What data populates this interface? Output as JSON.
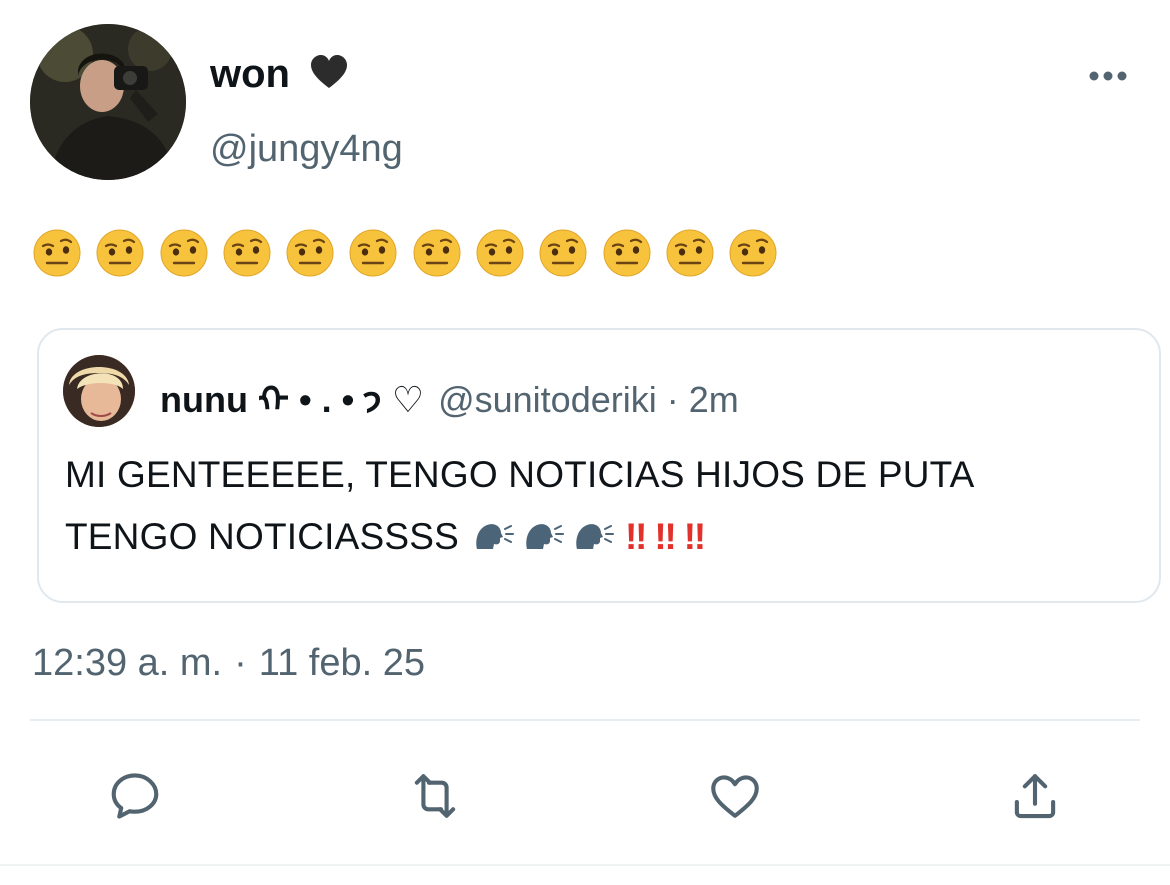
{
  "tweet": {
    "author": {
      "display_name": "won",
      "name_emoji": "black-heart",
      "handle": "@jungy4ng"
    },
    "body_emoji": "face-with-raised-eyebrow",
    "body_emoji_count": 12,
    "quoted": {
      "display_name": "nunu",
      "name_decoration": "ᡣ • . • 𐭩 ♡",
      "handle": "@sunitoderiki",
      "separator": "·",
      "time": "2m",
      "text_line1": "MI GENTEEEEE, TENGO NOTICIAS HIJOS DE PUTA",
      "text_line2": "TENGO NOTICIASSSS",
      "emoji_icons": [
        "speaking-head",
        "speaking-head",
        "speaking-head"
      ],
      "exclamations": [
        "‼",
        "‼",
        "‼"
      ]
    },
    "timestamp": {
      "time": "12:39 a. m.",
      "separator": "·",
      "date": "11 feb. 25"
    }
  },
  "actions": [
    {
      "name": "reply",
      "icon": "reply-icon"
    },
    {
      "name": "retweet",
      "icon": "retweet-icon"
    },
    {
      "name": "like",
      "icon": "heart-icon"
    },
    {
      "name": "share",
      "icon": "share-icon"
    }
  ],
  "colors": {
    "text": "#0f1419",
    "secondary": "#536471",
    "border": "#e1e8ed",
    "exclamation": "#e2302b",
    "emoji_yellow": "#f7c23c"
  }
}
